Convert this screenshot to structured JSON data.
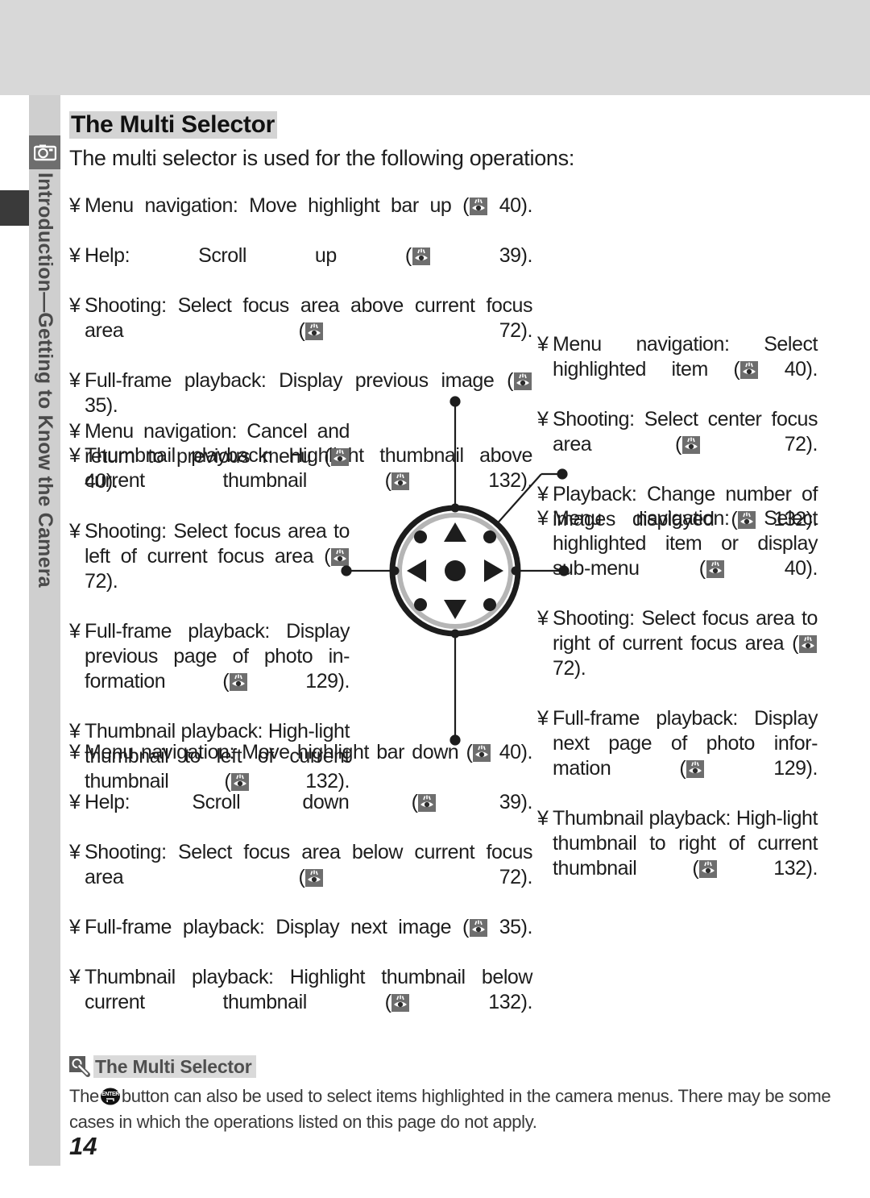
{
  "document": {
    "page_number": "14",
    "chapter_tab": "Introduction—Getting to Know the Camera",
    "chapter_icon": "camera-icon"
  },
  "header": {
    "title": "The Multi Selector",
    "intro": "The multi selector is used for the following operations:"
  },
  "diagram": {
    "name": "multi-selector-dial",
    "up_arrow": "triangle-up-icon",
    "down_arrow": "triangle-down-icon",
    "left_arrow": "triangle-left-icon",
    "right_arrow": "triangle-right-icon",
    "center_button": "center-dot-icon"
  },
  "bullets": {
    "up": [
      {
        "label": "Menu navigation",
        "desc": "Move highlight bar up (",
        "page": "40",
        "tail": ")."
      },
      {
        "label": "Help",
        "desc": "Scroll up (",
        "page": "39",
        "tail": ")."
      },
      {
        "label": "Shooting",
        "desc": "Select focus area above current focus area (",
        "page": "72",
        "tail": ")."
      },
      {
        "label": "Full-frame playback",
        "desc": "Display previous image (",
        "page": "35",
        "tail": ")."
      },
      {
        "label": "Thumbnail playback",
        "desc": "Highlight thumbnail above current thumbnail (",
        "page": "132",
        "tail": ")."
      }
    ],
    "left": [
      {
        "label": "Menu navigation",
        "desc": "Cancel and return to previous menu (",
        "page": "40",
        "tail": ")."
      },
      {
        "label": "Shooting",
        "desc": "Select focus area to left of current focus area (",
        "page": "72",
        "tail": ")."
      },
      {
        "label": "Full-frame playback",
        "desc": "Display previous page of photo in-formation (",
        "page": "129",
        "tail": ")."
      },
      {
        "label": "Thumbnail playback",
        "desc": "High-light thumbnail to left of current thumbnail (",
        "page": "132",
        "tail": ")."
      }
    ],
    "center": [
      {
        "label": "Menu navigation",
        "desc": "Select highlighted item (",
        "page": "40",
        "tail": ")."
      },
      {
        "label": "Shooting",
        "desc": "Select center focus area (",
        "page": "72",
        "tail": ")."
      },
      {
        "label": "Playback",
        "desc": "Change number of images displayed (",
        "page": "132",
        "tail": ")."
      }
    ],
    "right": [
      {
        "label": "Menu navigation",
        "desc": "Select highlighted item or display sub-menu (",
        "page": "40",
        "tail": ")."
      },
      {
        "label": "Shooting",
        "desc": "Select focus area to right of current focus area (",
        "page": "72",
        "tail": ")."
      },
      {
        "label": "Full-frame playback",
        "desc": "Display next page of photo infor-mation (",
        "page": "129",
        "tail": ")."
      },
      {
        "label": "Thumbnail playback",
        "desc": "High-light thumbnail to right of current thumbnail (",
        "page": "132",
        "tail": ")."
      }
    ],
    "down": [
      {
        "label": "Menu navigation",
        "desc": "Move highlight bar down (",
        "page": "40",
        "tail": ")."
      },
      {
        "label": "Help",
        "desc": "Scroll down (",
        "page": "39",
        "tail": ")."
      },
      {
        "label": "Shooting",
        "desc": "Select focus area below current focus area (",
        "page": "72",
        "tail": ")."
      },
      {
        "label": "Full-frame playback",
        "desc": "Display next image (",
        "page": "35",
        "tail": ")."
      },
      {
        "label": "Thumbnail playback",
        "desc": "Highlight thumbnail below current thumbnail (",
        "page": "132",
        "tail": ")."
      }
    ]
  },
  "bullet_mark": "¥",
  "note": {
    "icon": "magnifier-icon",
    "title": "The Multi Selector",
    "text_before": "The",
    "button_icon": "enter-button-icon",
    "text_after": "button can also be used to select items highlighted in the camera menus.  There may be some cases in which the operations listed on this page do not apply."
  },
  "colors": {
    "band_gray": "#d8d8d8",
    "tab_gray": "#cfcfcf",
    "tab_marker": "#3a3a3a",
    "icon_gray": "#6e6e6e",
    "highlight": "#d4d4d4",
    "text": "#1d1d1d"
  }
}
